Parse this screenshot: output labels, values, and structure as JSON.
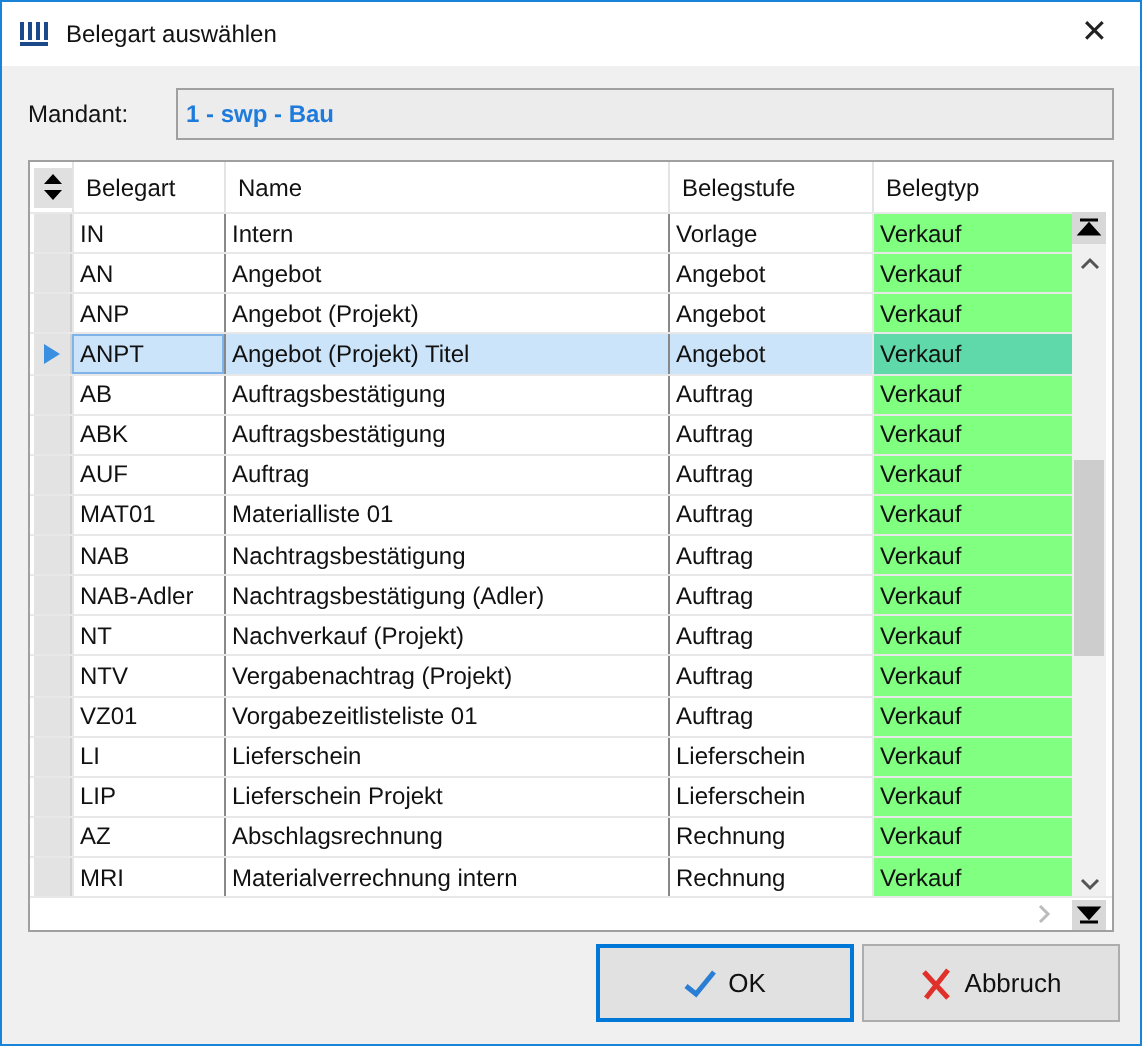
{
  "window": {
    "title": "Belegart auswählen",
    "close": "✕"
  },
  "mandant": {
    "label": "Mandant:",
    "value": "1 - swp - Bau"
  },
  "table": {
    "columns": [
      "Belegart",
      "Name",
      "Belegstufe",
      "Belegtyp"
    ],
    "rows": [
      {
        "cells": [
          "IN",
          "Intern",
          "Vorlage",
          "Verkauf"
        ],
        "selected": false
      },
      {
        "cells": [
          "AN",
          "Angebot",
          "Angebot",
          "Verkauf"
        ],
        "selected": false
      },
      {
        "cells": [
          "ANP",
          "Angebot (Projekt)",
          "Angebot",
          "Verkauf"
        ],
        "selected": false
      },
      {
        "cells": [
          "ANPT",
          "Angebot (Projekt) Titel",
          "Angebot",
          "Verkauf"
        ],
        "selected": true
      },
      {
        "cells": [
          "AB",
          "Auftragsbestätigung",
          "Auftrag",
          "Verkauf"
        ],
        "selected": false
      },
      {
        "cells": [
          "ABK",
          "Auftragsbestätigung",
          "Auftrag",
          "Verkauf"
        ],
        "selected": false
      },
      {
        "cells": [
          "AUF",
          "Auftrag",
          "Auftrag",
          "Verkauf"
        ],
        "selected": false
      },
      {
        "cells": [
          "MAT01",
          "Materialliste 01",
          "Auftrag",
          "Verkauf"
        ],
        "selected": false
      },
      {
        "cells": [
          "NAB",
          "Nachtragsbestätigung",
          "Auftrag",
          "Verkauf"
        ],
        "selected": false
      },
      {
        "cells": [
          "NAB-Adler",
          "Nachtragsbestätigung (Adler)",
          "Auftrag",
          "Verkauf"
        ],
        "selected": false
      },
      {
        "cells": [
          "NT",
          "Nachverkauf (Projekt)",
          "Auftrag",
          "Verkauf"
        ],
        "selected": false
      },
      {
        "cells": [
          "NTV",
          "Vergabenachtrag (Projekt)",
          "Auftrag",
          "Verkauf"
        ],
        "selected": false
      },
      {
        "cells": [
          "VZ01",
          "Vorgabezeitlisteliste 01",
          "Auftrag",
          "Verkauf"
        ],
        "selected": false
      },
      {
        "cells": [
          "LI",
          "Lieferschein",
          "Lieferschein",
          "Verkauf"
        ],
        "selected": false
      },
      {
        "cells": [
          "LIP",
          "Lieferschein Projekt",
          "Lieferschein",
          "Verkauf"
        ],
        "selected": false
      },
      {
        "cells": [
          "AZ",
          "Abschlagsrechnung",
          "Rechnung",
          "Verkauf"
        ],
        "selected": false
      },
      {
        "cells": [
          "MRI",
          "Materialverrechnung intern",
          "Rechnung",
          "Verkauf"
        ],
        "selected": false
      }
    ]
  },
  "buttons": [
    {
      "label": "OK",
      "kind": "ok"
    },
    {
      "label": "Abbruch",
      "kind": "cancel"
    }
  ]
}
